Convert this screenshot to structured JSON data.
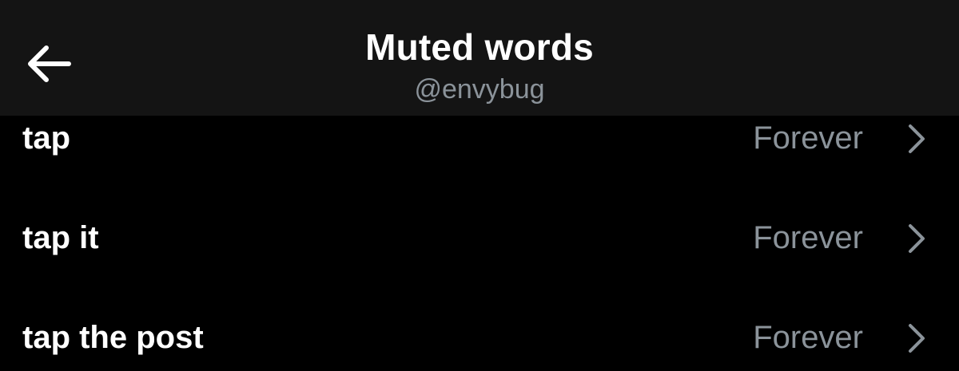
{
  "header": {
    "title": "Muted words",
    "subtitle": "@envybug",
    "back_icon": "arrow-left-icon"
  },
  "muted_words": [
    {
      "word": "tap",
      "duration": "Forever"
    },
    {
      "word": "tap it",
      "duration": "Forever"
    },
    {
      "word": "tap the post",
      "duration": "Forever"
    }
  ],
  "colors": {
    "background": "#000000",
    "header_background": "#141414",
    "primary_text": "#ffffff",
    "secondary_text": "#8b939a"
  }
}
